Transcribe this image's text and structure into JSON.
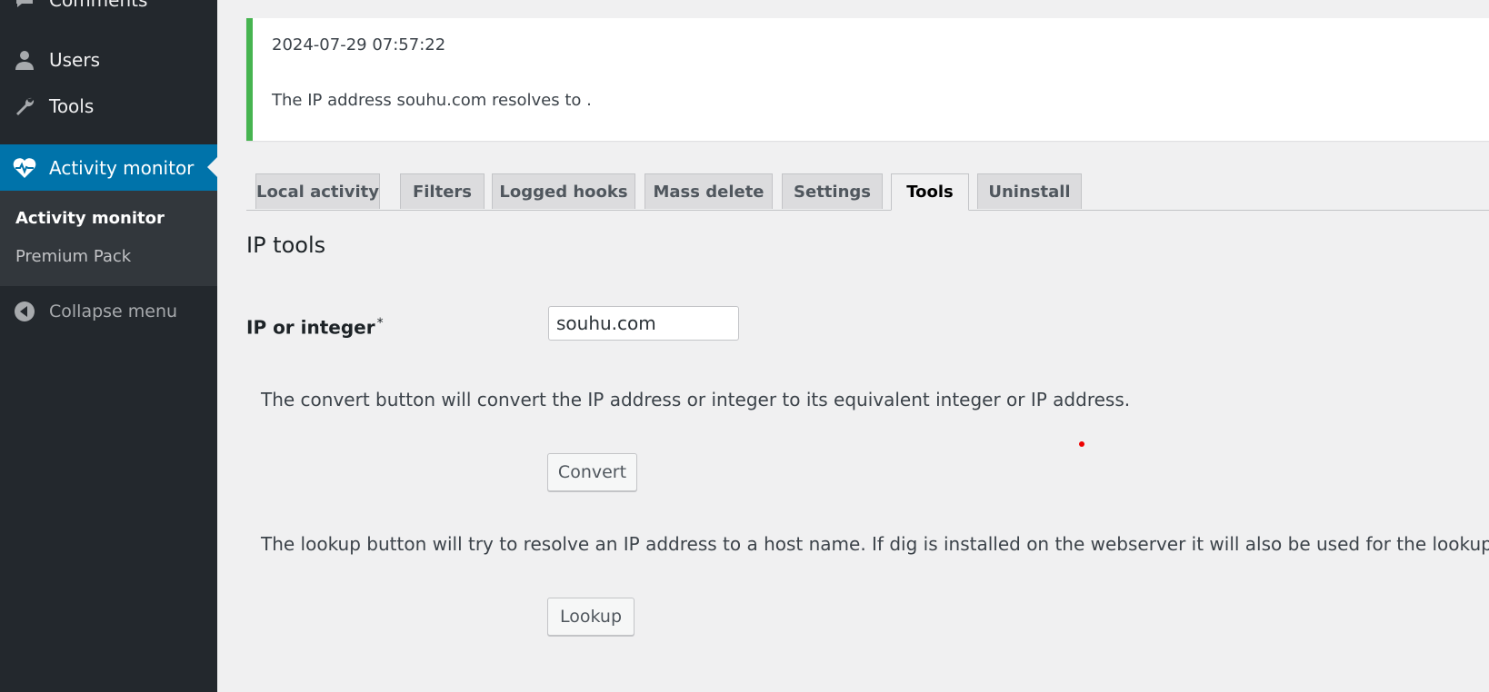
{
  "sidebar": {
    "comments_label": "Comments",
    "users_label": "Users",
    "tools_label": "Tools",
    "activity_label": "Activity monitor",
    "submenu": {
      "current": "Activity monitor",
      "premium": "Premium Pack"
    },
    "collapse_label": "Collapse menu",
    "active_color": "#0073aa"
  },
  "notice": {
    "timestamp": "2024-07-29 07:57:22",
    "message": "The IP address souhu.com resolves to .",
    "border_color": "#46b450"
  },
  "tabs": [
    {
      "label": "Local activity"
    },
    {
      "label": "Filters"
    },
    {
      "label": "Logged hooks"
    },
    {
      "label": "Mass delete"
    },
    {
      "label": "Settings"
    },
    {
      "label": "Tools"
    },
    {
      "label": "Uninstall"
    }
  ],
  "active_tab": "Tools",
  "main": {
    "title": "IP tools",
    "field_label": "IP or integer",
    "required_mark": "*",
    "input_value": "souhu.com",
    "convert_desc": "The convert button will convert the IP address or integer to its equivalent integer or IP address.",
    "convert_label": "Convert",
    "lookup_desc": "The lookup button will try to resolve an IP address to a host name. If dig is installed on the webserver it will also be used for the lookup.",
    "lookup_label": "Lookup"
  }
}
